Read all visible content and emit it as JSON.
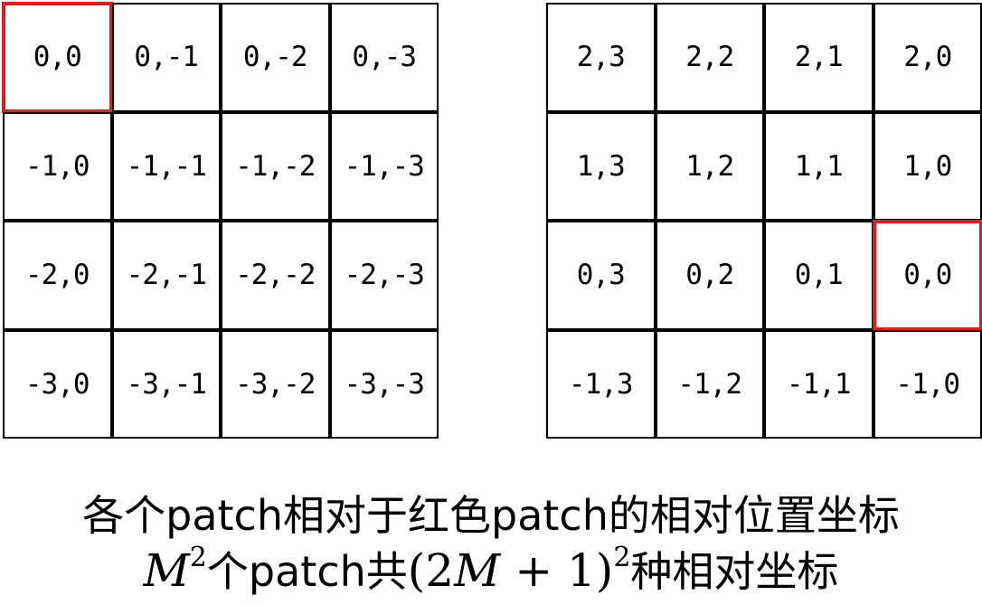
{
  "left_grid": {
    "rows": [
      [
        "0,0",
        "0,-1",
        "0,-2",
        "0,-3"
      ],
      [
        "-1,0",
        "-1,-1",
        "-1,-2",
        "-1,-3"
      ],
      [
        "-2,0",
        "-2,-1",
        "-2,-2",
        "-2,-3"
      ],
      [
        "-3,0",
        "-3,-1",
        "-3,-2",
        "-3,-3"
      ]
    ],
    "highlight_row": 0,
    "highlight_col": 0
  },
  "right_grid": {
    "rows": [
      [
        "2,3",
        "2,2",
        "2,1",
        "2,0"
      ],
      [
        "1,3",
        "1,2",
        "1,1",
        "1,0"
      ],
      [
        "0,3",
        "0,2",
        "0,1",
        "0,0"
      ],
      [
        "-1,3",
        "-1,2",
        "-1,1",
        "-1,0"
      ]
    ],
    "highlight_row": 2,
    "highlight_col": 3
  },
  "colors": {
    "grid_line": "#000000",
    "highlight": "#e41a1c"
  },
  "caption": {
    "line1": "各个patch相对于红色patch的相对位置坐标",
    "line2": {
      "m_symbol": "M",
      "exp1": "2",
      "text_a": "个patch共",
      "open_paren": "(",
      "two": "2",
      "m_symbol2": "M",
      "plus": " + ",
      "one": "1",
      "close_paren": ")",
      "exp2": "2",
      "text_b": "种相对坐标"
    }
  }
}
